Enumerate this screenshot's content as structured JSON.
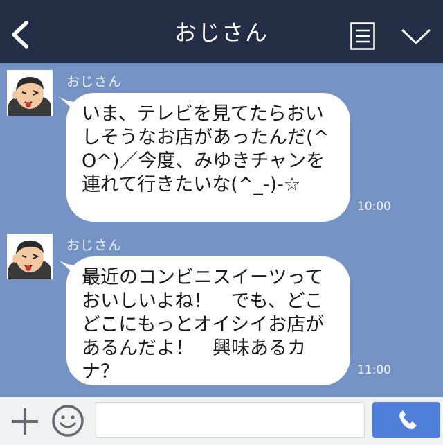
{
  "header": {
    "title": "おじさん",
    "back_icon": "chevron-left-icon",
    "menu_icon": "menu-lines-icon",
    "collapse_icon": "chevron-down-icon"
  },
  "messages": [
    {
      "sender": "おじさん",
      "text": "いま、テレビを見てたらおいしそうなお店があったんだ(^O^)／今度、みゆきチャンを連れて行きたいな(^_-)-☆",
      "time": "10:00"
    },
    {
      "sender": "おじさん",
      "text": "最近のコンビニスイーツっておいしいよね！　でも、どこどこにもっとオイシイお店があるんだよ！　興味あるカナ？",
      "time": "11:00"
    }
  ],
  "footer": {
    "input_value": "",
    "plus_icon": "plus-icon",
    "emoji_icon": "smiley-icon",
    "call_icon": "phone-icon"
  },
  "colors": {
    "header_bg": "#232d45",
    "chat_bg": "#7492c3",
    "call_button": "#4f7fd8"
  }
}
